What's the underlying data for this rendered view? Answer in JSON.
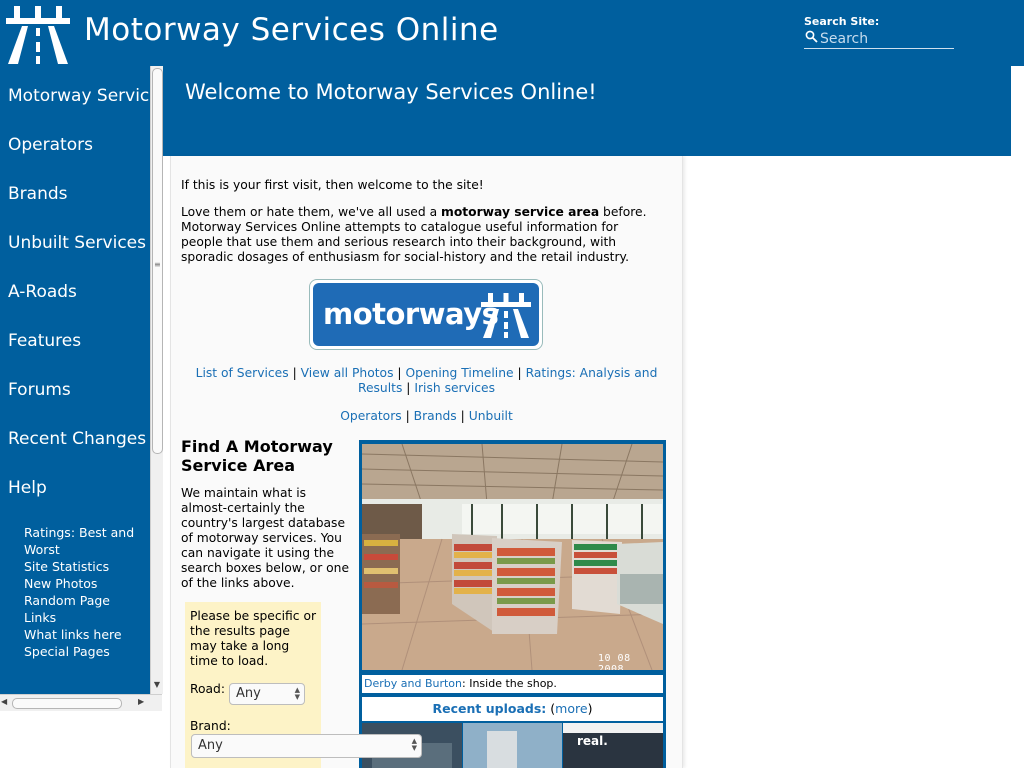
{
  "header": {
    "site_title": "Motorway Services Online",
    "search_label": "Search Site:",
    "search_placeholder": "Search"
  },
  "sidebar": {
    "items": [
      {
        "label": "Motorway Services"
      },
      {
        "label": "Operators"
      },
      {
        "label": "Brands"
      },
      {
        "label": "Unbuilt Services"
      },
      {
        "label": "A-Roads"
      },
      {
        "label": "Features"
      },
      {
        "label": "Forums"
      },
      {
        "label": "Recent Changes"
      },
      {
        "label": "Help"
      }
    ],
    "sub_items": [
      {
        "label": "Ratings: Best and Worst"
      },
      {
        "label": "Site Statistics"
      },
      {
        "label": "New Photos"
      },
      {
        "label": "Random Page"
      },
      {
        "label": "Links"
      },
      {
        "label": "What links here"
      },
      {
        "label": "Special Pages"
      }
    ]
  },
  "page": {
    "title": "Welcome to Motorway Services Online!",
    "intro_1": "If this is your first visit, then welcome to the site!",
    "intro_2_prefix": "Love them or hate them, we've all used a ",
    "intro_2_bold": "motorway service area",
    "intro_2_suffix": " before. Motorway Services Online attempts to catalogue useful information for people that use them and serious research into their background, with sporadic dosages of enthusiasm for social-history and the retail industry.",
    "sign_text": "motorways",
    "links_row_1": [
      "List of Services",
      "View all Photos",
      "Opening Timeline",
      "Ratings: Analysis and Results",
      "Irish services"
    ],
    "links_row_2": [
      "Operators",
      "Brands",
      "Unbuilt"
    ],
    "separator": "|",
    "find_title": "Find A Motorway Service Area",
    "find_desc": "We maintain what is almost-certainly the country's largest database of motorway services. You can navigate it using the search boxes below, or one of the links above.",
    "search_note": "Please be specific or the results page may take a long time to load.",
    "road_label": "Road:",
    "road_value": "Any",
    "brand_label": "Brand:",
    "brand_value": "Any"
  },
  "photo": {
    "date_stamp": "10 08 2008",
    "caption_link": "Derby and Burton",
    "caption_text": ": Inside the shop.",
    "recent_label": "Recent uploads:",
    "recent_more_open": " (",
    "recent_more_link": "more",
    "recent_more_close": ")",
    "thumb_sign_text": "real."
  },
  "colors": {
    "brand_blue": "#005f9e",
    "link_blue": "#1a6fb5",
    "search_panel_bg": "#fdf3c7"
  }
}
